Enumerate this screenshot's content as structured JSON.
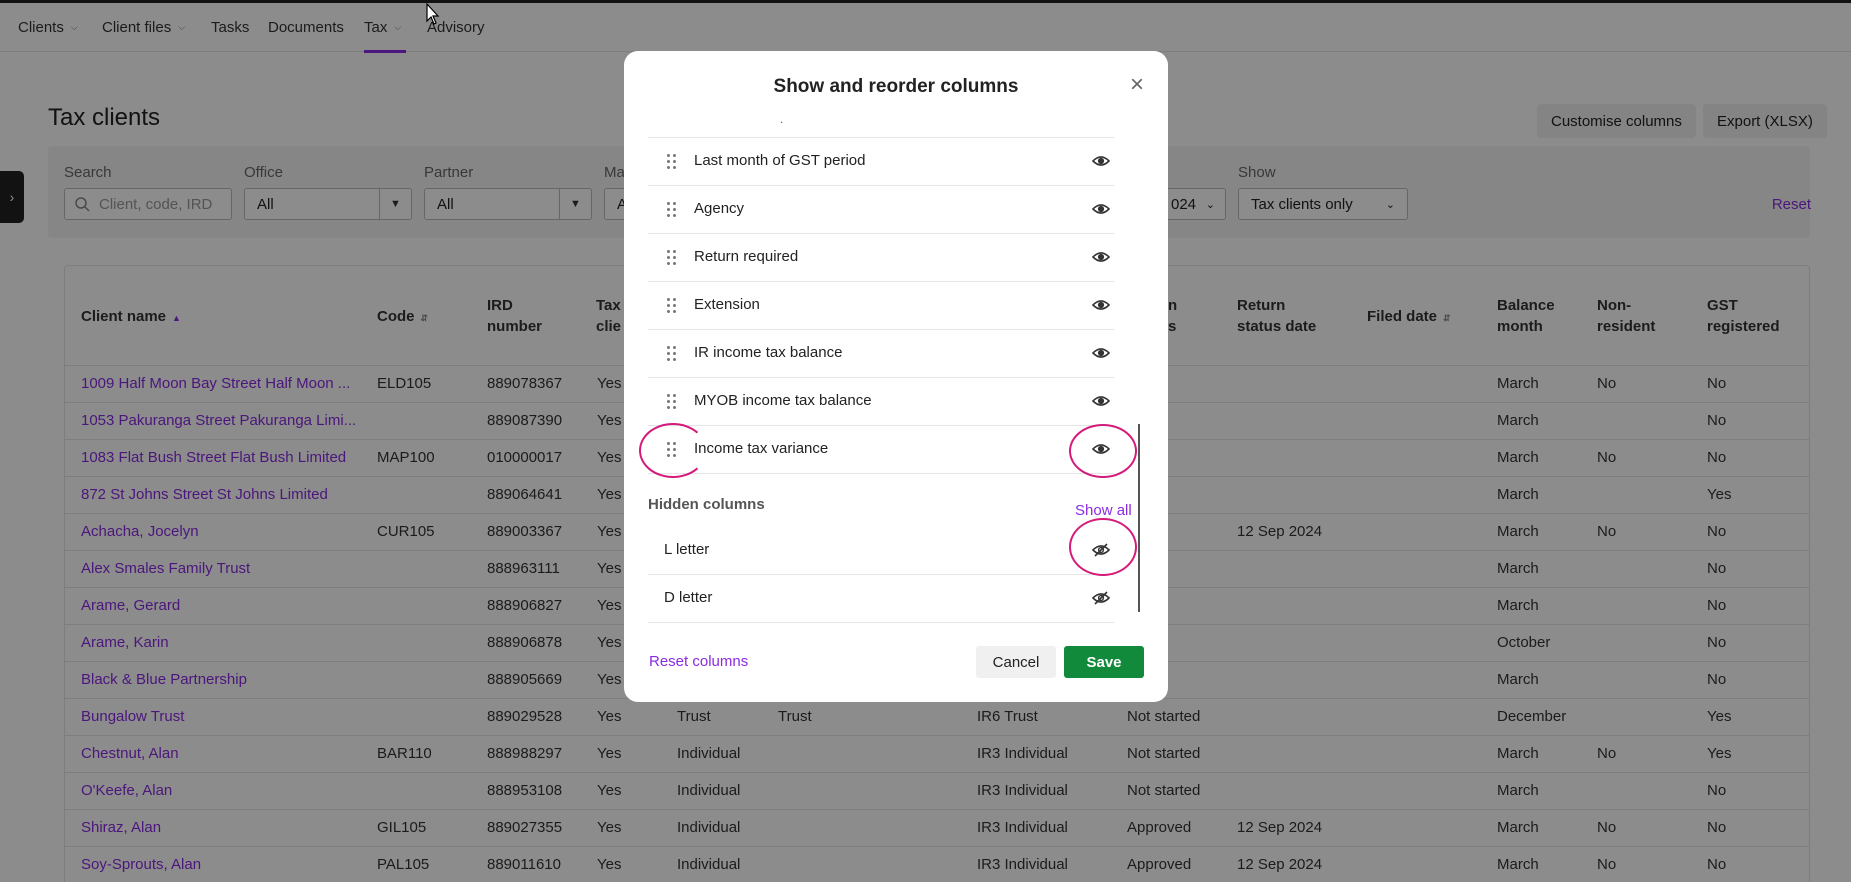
{
  "nav": {
    "items": [
      {
        "label": "Clients",
        "dropdown": true
      },
      {
        "label": "Client files",
        "dropdown": true
      },
      {
        "label": "Tasks",
        "dropdown": false
      },
      {
        "label": "Documents",
        "dropdown": false
      },
      {
        "label": "Tax",
        "dropdown": true,
        "active": true
      },
      {
        "label": "Advisory",
        "dropdown": false
      }
    ]
  },
  "page": {
    "title": "Tax clients",
    "customise_label": "Customise columns",
    "export_label": "Export (XLSX)"
  },
  "filters": {
    "search_label": "Search",
    "search_placeholder": "Client, code, IRD",
    "office_label": "Office",
    "office_value": "All",
    "partner_label": "Partner",
    "partner_value": "All",
    "manager_label_partial": "Ma",
    "manager_value_partial": "A",
    "period_label_partial": "od",
    "period_value_partial": "024",
    "show_label": "Show",
    "show_value": "Tax clients only",
    "reset_label": "Reset"
  },
  "table": {
    "headers": {
      "client_name": "Client name",
      "code": "Code",
      "ird_1": "IRD",
      "ird_2": "number",
      "tax_1": "Tax",
      "tax_2": "clie",
      "status_1": "n",
      "status_2": "s",
      "return_status_date_1": "Return",
      "return_status_date_2": "status date",
      "filed_date": "Filed date",
      "balance_month_1": "Balance",
      "balance_month_2": "month",
      "non_resident_1": "Non-",
      "non_resident_2": "resident",
      "gst_1": "GST",
      "gst_2": "registered"
    },
    "rows": [
      {
        "name": "1009 Half Moon Bay Street Half Moon ...",
        "code": "ELD105",
        "ird": "889078367",
        "tax": "Yes",
        "entity": "",
        "entity2": "",
        "return_type": "",
        "status": "arted",
        "status_date": "",
        "filed": "",
        "month": "March",
        "nonres": "No",
        "gst": "No"
      },
      {
        "name": "1053 Pakuranga Street Pakuranga Limi...",
        "code": "",
        "ird": "889087390",
        "tax": "Yes",
        "entity": "",
        "entity2": "",
        "return_type": "",
        "status": "arted",
        "status_date": "",
        "filed": "",
        "month": "March",
        "nonres": "",
        "gst": "No"
      },
      {
        "name": "1083 Flat Bush Street Flat Bush Limited",
        "code": "MAP100",
        "ird": "010000017",
        "tax": "Yes",
        "entity": "",
        "entity2": "",
        "return_type": "",
        "status": "arted",
        "status_date": "",
        "filed": "",
        "month": "March",
        "nonres": "No",
        "gst": "No"
      },
      {
        "name": "872 St Johns Street St Johns Limited",
        "code": "",
        "ird": "889064641",
        "tax": "Yes",
        "entity": "",
        "entity2": "",
        "return_type": "",
        "status": "arted",
        "status_date": "",
        "filed": "",
        "month": "March",
        "nonres": "",
        "gst": "Yes"
      },
      {
        "name": "Achacha, Jocelyn",
        "code": "CUR105",
        "ird": "889003367",
        "tax": "Yes",
        "entity": "",
        "entity2": "",
        "return_type": "",
        "status": "oved",
        "status_date": "12 Sep 2024",
        "filed": "",
        "month": "March",
        "nonres": "No",
        "gst": "No"
      },
      {
        "name": "Alex Smales Family Trust",
        "code": "",
        "ird": "888963111",
        "tax": "Yes",
        "entity": "",
        "entity2": "",
        "return_type": "",
        "status": "arted",
        "status_date": "",
        "filed": "",
        "month": "March",
        "nonres": "",
        "gst": "No"
      },
      {
        "name": "Arame, Gerard",
        "code": "",
        "ird": "888906827",
        "tax": "Yes",
        "entity": "",
        "entity2": "",
        "return_type": "",
        "status": "arted",
        "status_date": "",
        "filed": "",
        "month": "March",
        "nonres": "",
        "gst": "No"
      },
      {
        "name": "Arame, Karin",
        "code": "",
        "ird": "888906878",
        "tax": "Yes",
        "entity": "",
        "entity2": "",
        "return_type": "",
        "status": "arted",
        "status_date": "",
        "filed": "",
        "month": "October",
        "nonres": "",
        "gst": "No"
      },
      {
        "name": "Black & Blue Partnership",
        "code": "",
        "ird": "888905669",
        "tax": "Yes",
        "entity": "",
        "entity2": "",
        "return_type": "",
        "status": "arted",
        "status_date": "",
        "filed": "",
        "month": "March",
        "nonres": "",
        "gst": "No"
      },
      {
        "name": "Bungalow Trust",
        "code": "",
        "ird": "889029528",
        "tax": "Yes",
        "entity": "Trust",
        "entity2": "Trust",
        "return_type": "IR6 Trust",
        "status": "Not started",
        "status_date": "",
        "filed": "",
        "month": "December",
        "nonres": "",
        "gst": "Yes"
      },
      {
        "name": "Chestnut, Alan",
        "code": "BAR110",
        "ird": "888988297",
        "tax": "Yes",
        "entity": "Individual",
        "entity2": "",
        "return_type": "IR3 Individual",
        "status": "Not started",
        "status_date": "",
        "filed": "",
        "month": "March",
        "nonres": "No",
        "gst": "Yes"
      },
      {
        "name": "O'Keefe, Alan",
        "code": "",
        "ird": "888953108",
        "tax": "Yes",
        "entity": "Individual",
        "entity2": "",
        "return_type": "IR3 Individual",
        "status": "Not started",
        "status_date": "",
        "filed": "",
        "month": "March",
        "nonres": "",
        "gst": "No"
      },
      {
        "name": "Shiraz, Alan",
        "code": "GIL105",
        "ird": "889027355",
        "tax": "Yes",
        "entity": "Individual",
        "entity2": "",
        "return_type": "IR3 Individual",
        "status": "Approved",
        "status_date": "12 Sep 2024",
        "filed": "",
        "month": "March",
        "nonres": "No",
        "gst": "No"
      },
      {
        "name": "Soy-Sprouts, Alan",
        "code": "PAL105",
        "ird": "889011610",
        "tax": "Yes",
        "entity": "Individual",
        "entity2": "",
        "return_type": "IR3 Individual",
        "status": "Approved",
        "status_date": "12 Sep 2024",
        "filed": "",
        "month": "March",
        "nonres": "No",
        "gst": "No"
      }
    ]
  },
  "modal": {
    "title": "Show and reorder columns",
    "close_icon": "close-icon",
    "visible_columns": [
      "Last month of GST period",
      "Agency",
      "Return required",
      "Extension",
      "IR income tax balance",
      "MYOB income tax balance",
      "Income tax variance"
    ],
    "hidden_heading": "Hidden columns",
    "show_all_label": "Show all",
    "hidden_columns": [
      "L letter",
      "D letter"
    ],
    "reset_label": "Reset columns",
    "cancel_label": "Cancel",
    "save_label": "Save"
  },
  "colors": {
    "accent": "#8a2be2",
    "save": "#128a3c",
    "annotation": "#d41a7a"
  }
}
